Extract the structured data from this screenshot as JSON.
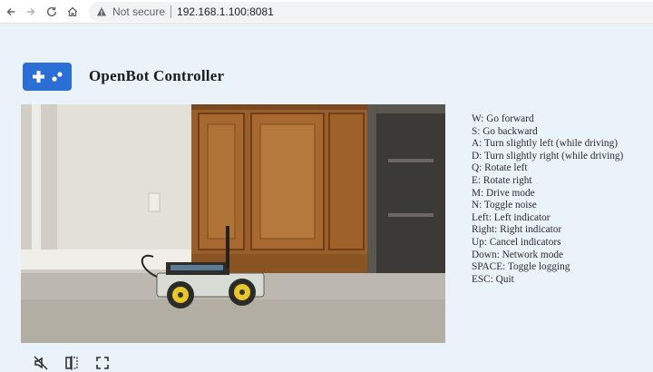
{
  "browser": {
    "security_label": "Not secure",
    "url": "192.168.1.100:8081",
    "icons": [
      "back-arrow-icon",
      "forward-arrow-icon",
      "reload-icon",
      "home-icon",
      "warning-triangle-icon"
    ]
  },
  "header": {
    "title": "OpenBot Controller",
    "logo_icon": "gamepad-icon",
    "accent_color": "#2b6fd6"
  },
  "video_controls": {
    "icons": [
      "mute-icon",
      "mirror-icon",
      "fullscreen-icon"
    ]
  },
  "keys": [
    {
      "label": "W: Go forward"
    },
    {
      "label": "S: Go backward"
    },
    {
      "label": "A: Turn slightly left (while driving)"
    },
    {
      "label": "D: Turn slightly right (while driving)"
    },
    {
      "label": "Q: Rotate left"
    },
    {
      "label": "E: Rotate right"
    },
    {
      "label": "M: Drive mode"
    },
    {
      "label": "N: Toggle noise"
    },
    {
      "label": "Left: Left indicator"
    },
    {
      "label": "Right: Right indicator"
    },
    {
      "label": "Up: Cancel indicators"
    },
    {
      "label": "Down: Network mode"
    },
    {
      "label": "SPACE: Toggle logging"
    },
    {
      "label": "ESC: Quit"
    }
  ]
}
